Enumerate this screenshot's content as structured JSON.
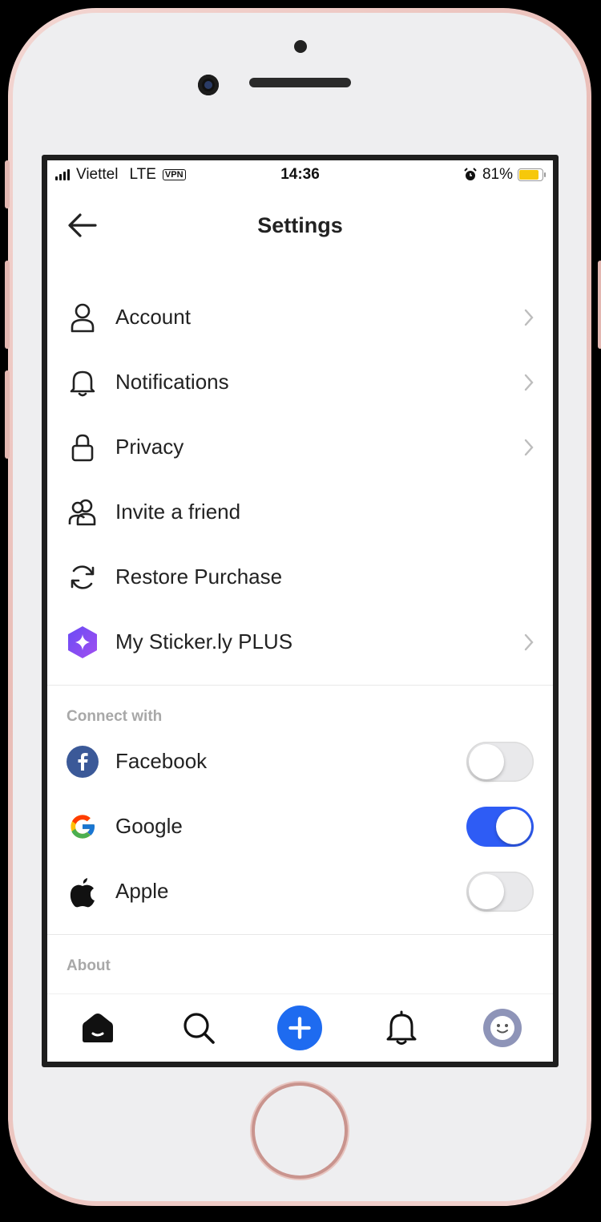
{
  "status_bar": {
    "carrier": "Viettel",
    "network": "LTE",
    "vpn": "VPN",
    "time": "14:36",
    "battery": "81%",
    "battery_level": 0.81,
    "battery_color": "#f6c80b"
  },
  "header": {
    "title": "Settings"
  },
  "menu": [
    {
      "label": "Account",
      "icon": "person-icon",
      "chevron": true
    },
    {
      "label": "Notifications",
      "icon": "bell-icon",
      "chevron": true
    },
    {
      "label": "Privacy",
      "icon": "lock-icon",
      "chevron": true
    },
    {
      "label": "Invite a friend",
      "icon": "people-icon",
      "chevron": false
    },
    {
      "label": "Restore Purchase",
      "icon": "refresh-icon",
      "chevron": false
    },
    {
      "label": "My Sticker.ly PLUS",
      "icon": "plus-badge-icon",
      "chevron": true
    }
  ],
  "connect": {
    "heading": "Connect with",
    "items": [
      {
        "label": "Facebook",
        "icon": "facebook-icon",
        "on": false
      },
      {
        "label": "Google",
        "icon": "google-icon",
        "on": true
      },
      {
        "label": "Apple",
        "icon": "apple-icon",
        "on": false
      }
    ]
  },
  "about": {
    "heading": "About"
  },
  "tabbar": [
    "home-icon",
    "search-icon",
    "create-plus-icon",
    "notifications-bell-icon",
    "profile-avatar-icon"
  ],
  "colors": {
    "accent": "#2e5cf5",
    "create_button": "#1e6bf0",
    "facebook": "#3b5998"
  }
}
